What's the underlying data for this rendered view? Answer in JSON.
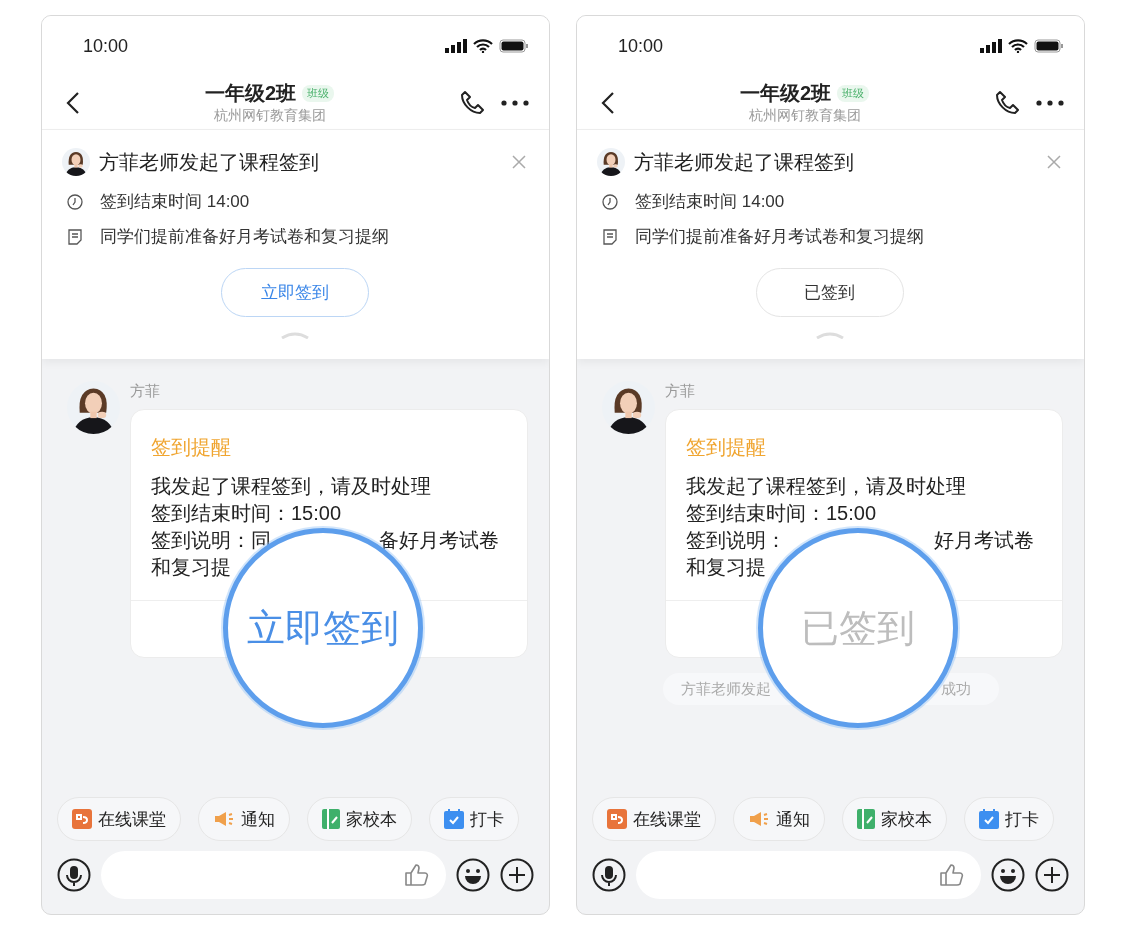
{
  "phones": [
    {
      "status": {
        "time": "10:00"
      },
      "header": {
        "title": "一年级2班",
        "badge": "班级",
        "subtitle": "杭州网钉教育集团"
      },
      "banner": {
        "title": "方菲老师发起了课程签到",
        "end_time": "签到结束时间 14:00",
        "note": "同学们提前准备好月考试卷和复习提纲",
        "button": {
          "label": "立即签到",
          "signed": false
        }
      },
      "message": {
        "sender": "方菲",
        "card": {
          "title": "签到提醒",
          "lines": [
            {
              "parts": [
                "我发起了课程签到，请及时处理"
              ]
            },
            {
              "parts": [
                "签到结束时间：15:00"
              ]
            },
            {
              "parts": [
                "签到说明：同",
                "备好月考试卷"
              ]
            },
            {
              "parts": [
                "和复习提"
              ]
            }
          ]
        },
        "magnifier": {
          "label": "立即签到",
          "signed": false
        }
      },
      "quick_actions": [
        {
          "label": "在线课堂",
          "kind": "classroom"
        },
        {
          "label": "通知",
          "kind": "notice"
        },
        {
          "label": "家校本",
          "kind": "homework"
        },
        {
          "label": "打卡",
          "kind": "checkin"
        }
      ]
    },
    {
      "status": {
        "time": "10:00"
      },
      "header": {
        "title": "一年级2班",
        "badge": "班级",
        "subtitle": "杭州网钉教育集团"
      },
      "banner": {
        "title": "方菲老师发起了课程签到",
        "end_time": "签到结束时间 14:00",
        "note": "同学们提前准备好月考试卷和复习提纲",
        "button": {
          "label": "已签到",
          "signed": true
        }
      },
      "message": {
        "sender": "方菲",
        "card": {
          "title": "签到提醒",
          "lines": [
            {
              "parts": [
                "我发起了课程签到，请及时处理"
              ]
            },
            {
              "parts": [
                "签到结束时间：15:00"
              ]
            },
            {
              "parts": [
                "签到说明：",
                "好月考试卷"
              ]
            },
            {
              "parts": [
                "和复习提"
              ]
            }
          ]
        },
        "magnifier": {
          "label": "已签到",
          "signed": true
        }
      },
      "notice": {
        "parts": [
          "方菲老师发起",
          "成功"
        ]
      },
      "quick_actions": [
        {
          "label": "在线课堂",
          "kind": "classroom"
        },
        {
          "label": "通知",
          "kind": "notice"
        },
        {
          "label": "家校本",
          "kind": "homework"
        },
        {
          "label": "打卡",
          "kind": "checkin"
        }
      ]
    }
  ]
}
